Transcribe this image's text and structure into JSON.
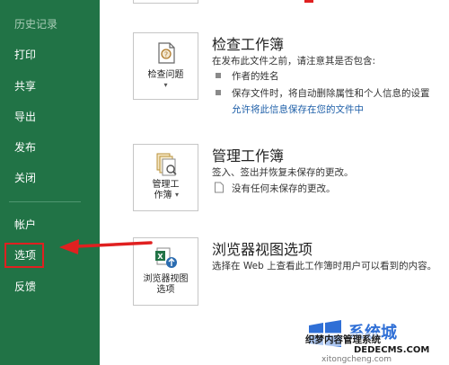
{
  "sidebar": {
    "items": [
      {
        "label": "历史记录",
        "muted": true
      },
      {
        "label": "打印"
      },
      {
        "label": "共享"
      },
      {
        "label": "导出"
      },
      {
        "label": "发布"
      },
      {
        "label": "关闭"
      },
      {
        "label": "帐户"
      },
      {
        "label": "选项"
      },
      {
        "label": "反馈"
      }
    ]
  },
  "sections": {
    "inspect": {
      "button_line1": "检查问题",
      "title": "检查工作簿",
      "desc": "在发布此文件之前，请注意其是否包含:",
      "bullet1": "作者的姓名",
      "bullet2": "保存文件时，将自动删除属性和个人信息的设置",
      "link": "允许将此信息保存在您的文件中"
    },
    "manage": {
      "button_line1": "管理工",
      "button_line2": "作簿",
      "title": "管理工作簿",
      "desc": "签入、签出并恢复未保存的更改。",
      "note": "没有任何未保存的更改。"
    },
    "browser": {
      "button_line1": "浏览器视图",
      "button_line2": "选项",
      "title": "浏览器视图选项",
      "desc": "选择在 Web 上查看此工作簿时用户可以看到的内容。"
    }
  },
  "watermark": {
    "line1": "系统城",
    "line2": "织梦内容管理系统",
    "line3": "DEDECMS.COM",
    "line4": "xitongcheng.com"
  },
  "colors": {
    "sidebar_bg": "#217346",
    "highlight": "#e02020",
    "link": "#1e5fa8"
  }
}
